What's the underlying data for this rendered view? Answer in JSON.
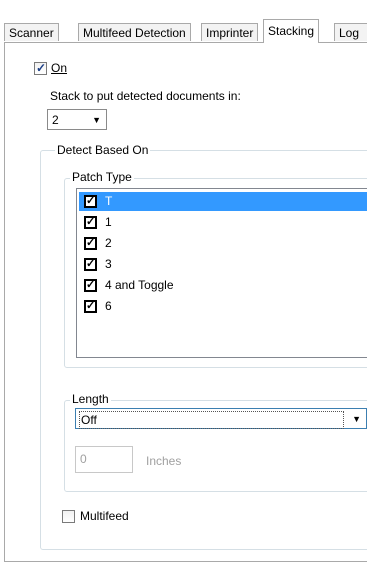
{
  "tabs": [
    {
      "label": "Scanner",
      "active": false
    },
    {
      "label": "Multifeed Detection",
      "active": false
    },
    {
      "label": "Imprinter",
      "active": false
    },
    {
      "label": "Stacking",
      "active": true
    },
    {
      "label": "Log",
      "active": false
    }
  ],
  "on_checkbox": {
    "label": "On",
    "checked": true
  },
  "stack_label": "Stack to put detected documents in:",
  "stack_select": {
    "value": "2"
  },
  "detect_group": {
    "legend": "Detect Based On"
  },
  "patch_group": {
    "legend": "Patch Type",
    "items": [
      {
        "label": "T",
        "checked": true,
        "selected": true
      },
      {
        "label": "1",
        "checked": true,
        "selected": false
      },
      {
        "label": "2",
        "checked": true,
        "selected": false
      },
      {
        "label": "3",
        "checked": true,
        "selected": false
      },
      {
        "label": "4 and Toggle",
        "checked": true,
        "selected": false
      },
      {
        "label": "6",
        "checked": true,
        "selected": false
      }
    ]
  },
  "length_group": {
    "legend": "Length",
    "select_value": "Off",
    "input_value": "0",
    "units_label": "Inches"
  },
  "multifeed_checkbox": {
    "label": "Multifeed",
    "checked": false
  },
  "colors": {
    "selection": "#3399ff",
    "border": "#a9a9a9"
  }
}
